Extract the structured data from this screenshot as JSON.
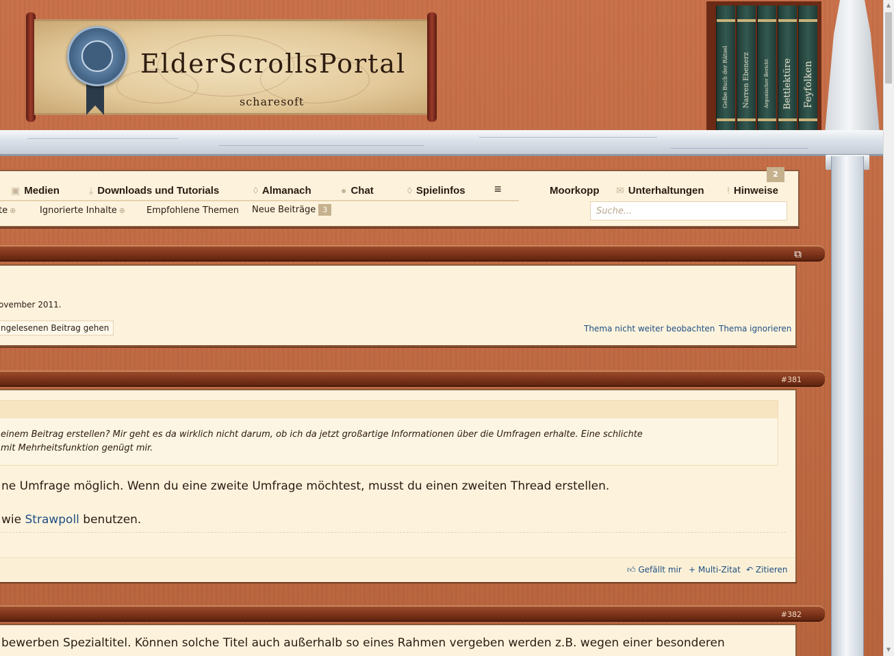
{
  "header": {
    "logo_title": "ElderScrollsPortal",
    "logo_subtitle": "scharesoft",
    "books": [
      "Gelbe Buch der Rätsel",
      "Narren Ebenerz",
      "Argonischer Bericht",
      "Bettlektüre",
      "Feyfolken"
    ]
  },
  "nav": {
    "items": [
      {
        "label": "Medien",
        "icon": "image-icon"
      },
      {
        "label": "Downloads und Tutorials",
        "icon": "download-icon"
      },
      {
        "label": "Almanach",
        "icon": "book-icon"
      },
      {
        "label": "Chat",
        "icon": "chat-bubble-icon"
      },
      {
        "label": "Spielinfos",
        "icon": "info-icon"
      },
      {
        "label": "≡",
        "icon": "menu-icon"
      }
    ],
    "user": {
      "name": "Moorkopp",
      "conversations": "Unterhaltungen",
      "alerts": "Hinweise",
      "alerts_count": "2"
    },
    "subnav": {
      "prev_partial": "te",
      "ignored": "Ignorierte Inhalte",
      "recommended": "Empfohlene Themen",
      "new_posts": "Neue Beiträge",
      "new_posts_count": "3"
    },
    "search_placeholder": "Suche..."
  },
  "thread": {
    "start_date": "ovember 2011.",
    "unread_button": "ngelesenen Beitrag gehen",
    "unwatch": "Thema nicht weiter beobachten",
    "ignore": "Thema ignorieren"
  },
  "posts": [
    {
      "number": "#381",
      "quote_lines": [
        "einem Beitrag erstellen? Mir geht es da wirklich nicht darum, ob ich da jetzt großartige Informationen über die Umfragen erhalte. Eine schlichte",
        "mit Mehrheitsfunktion genügt mir."
      ],
      "text_line1": "ne Umfrage möglich. Wenn du eine zweite Umfrage möchtest, musst du einen zweiten Thread erstellen.",
      "text_line2_prefix": "wie ",
      "text_line2_link": "Strawpoll",
      "text_line2_suffix": " benutzen.",
      "actions": {
        "like": "Gefällt mir",
        "multiquote": "+ Multi-Zitat",
        "quote": "Zitieren"
      }
    },
    {
      "number": "#382",
      "text_line1": "bewerben Spezialtitel. Können solche Titel auch außerhalb so eines Rahmen vergeben werden z.B. wegen einer besonderen"
    }
  ],
  "colors": {
    "link": "#1f4e82",
    "panel_bg": "#fdf3dd",
    "wood": "#b8663f",
    "badge": "#c6b18e"
  }
}
